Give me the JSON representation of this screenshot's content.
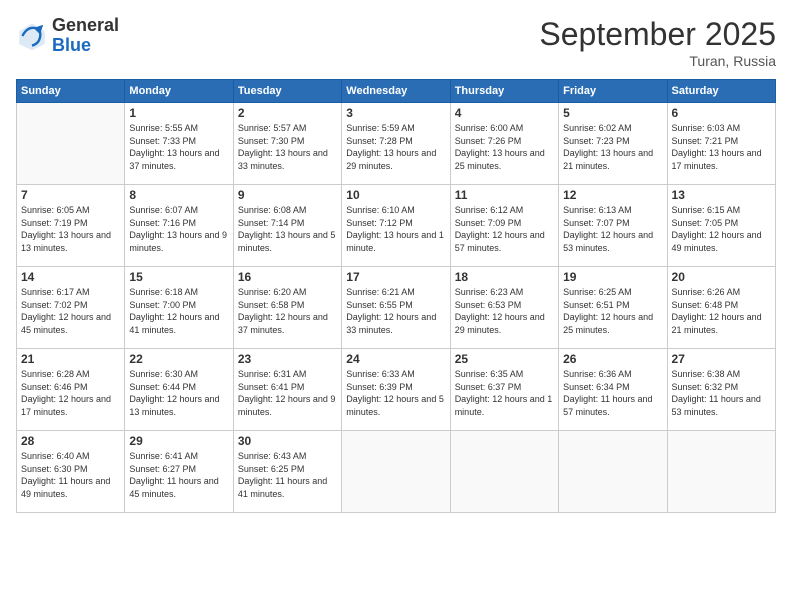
{
  "logo": {
    "general": "General",
    "blue": "Blue"
  },
  "title": {
    "month_year": "September 2025",
    "location": "Turan, Russia"
  },
  "weekdays": [
    "Sunday",
    "Monday",
    "Tuesday",
    "Wednesday",
    "Thursday",
    "Friday",
    "Saturday"
  ],
  "weeks": [
    [
      {
        "day": "",
        "sunrise": "",
        "sunset": "",
        "daylight": ""
      },
      {
        "day": "1",
        "sunrise": "Sunrise: 5:55 AM",
        "sunset": "Sunset: 7:33 PM",
        "daylight": "Daylight: 13 hours and 37 minutes."
      },
      {
        "day": "2",
        "sunrise": "Sunrise: 5:57 AM",
        "sunset": "Sunset: 7:30 PM",
        "daylight": "Daylight: 13 hours and 33 minutes."
      },
      {
        "day": "3",
        "sunrise": "Sunrise: 5:59 AM",
        "sunset": "Sunset: 7:28 PM",
        "daylight": "Daylight: 13 hours and 29 minutes."
      },
      {
        "day": "4",
        "sunrise": "Sunrise: 6:00 AM",
        "sunset": "Sunset: 7:26 PM",
        "daylight": "Daylight: 13 hours and 25 minutes."
      },
      {
        "day": "5",
        "sunrise": "Sunrise: 6:02 AM",
        "sunset": "Sunset: 7:23 PM",
        "daylight": "Daylight: 13 hours and 21 minutes."
      },
      {
        "day": "6",
        "sunrise": "Sunrise: 6:03 AM",
        "sunset": "Sunset: 7:21 PM",
        "daylight": "Daylight: 13 hours and 17 minutes."
      }
    ],
    [
      {
        "day": "7",
        "sunrise": "Sunrise: 6:05 AM",
        "sunset": "Sunset: 7:19 PM",
        "daylight": "Daylight: 13 hours and 13 minutes."
      },
      {
        "day": "8",
        "sunrise": "Sunrise: 6:07 AM",
        "sunset": "Sunset: 7:16 PM",
        "daylight": "Daylight: 13 hours and 9 minutes."
      },
      {
        "day": "9",
        "sunrise": "Sunrise: 6:08 AM",
        "sunset": "Sunset: 7:14 PM",
        "daylight": "Daylight: 13 hours and 5 minutes."
      },
      {
        "day": "10",
        "sunrise": "Sunrise: 6:10 AM",
        "sunset": "Sunset: 7:12 PM",
        "daylight": "Daylight: 13 hours and 1 minute."
      },
      {
        "day": "11",
        "sunrise": "Sunrise: 6:12 AM",
        "sunset": "Sunset: 7:09 PM",
        "daylight": "Daylight: 12 hours and 57 minutes."
      },
      {
        "day": "12",
        "sunrise": "Sunrise: 6:13 AM",
        "sunset": "Sunset: 7:07 PM",
        "daylight": "Daylight: 12 hours and 53 minutes."
      },
      {
        "day": "13",
        "sunrise": "Sunrise: 6:15 AM",
        "sunset": "Sunset: 7:05 PM",
        "daylight": "Daylight: 12 hours and 49 minutes."
      }
    ],
    [
      {
        "day": "14",
        "sunrise": "Sunrise: 6:17 AM",
        "sunset": "Sunset: 7:02 PM",
        "daylight": "Daylight: 12 hours and 45 minutes."
      },
      {
        "day": "15",
        "sunrise": "Sunrise: 6:18 AM",
        "sunset": "Sunset: 7:00 PM",
        "daylight": "Daylight: 12 hours and 41 minutes."
      },
      {
        "day": "16",
        "sunrise": "Sunrise: 6:20 AM",
        "sunset": "Sunset: 6:58 PM",
        "daylight": "Daylight: 12 hours and 37 minutes."
      },
      {
        "day": "17",
        "sunrise": "Sunrise: 6:21 AM",
        "sunset": "Sunset: 6:55 PM",
        "daylight": "Daylight: 12 hours and 33 minutes."
      },
      {
        "day": "18",
        "sunrise": "Sunrise: 6:23 AM",
        "sunset": "Sunset: 6:53 PM",
        "daylight": "Daylight: 12 hours and 29 minutes."
      },
      {
        "day": "19",
        "sunrise": "Sunrise: 6:25 AM",
        "sunset": "Sunset: 6:51 PM",
        "daylight": "Daylight: 12 hours and 25 minutes."
      },
      {
        "day": "20",
        "sunrise": "Sunrise: 6:26 AM",
        "sunset": "Sunset: 6:48 PM",
        "daylight": "Daylight: 12 hours and 21 minutes."
      }
    ],
    [
      {
        "day": "21",
        "sunrise": "Sunrise: 6:28 AM",
        "sunset": "Sunset: 6:46 PM",
        "daylight": "Daylight: 12 hours and 17 minutes."
      },
      {
        "day": "22",
        "sunrise": "Sunrise: 6:30 AM",
        "sunset": "Sunset: 6:44 PM",
        "daylight": "Daylight: 12 hours and 13 minutes."
      },
      {
        "day": "23",
        "sunrise": "Sunrise: 6:31 AM",
        "sunset": "Sunset: 6:41 PM",
        "daylight": "Daylight: 12 hours and 9 minutes."
      },
      {
        "day": "24",
        "sunrise": "Sunrise: 6:33 AM",
        "sunset": "Sunset: 6:39 PM",
        "daylight": "Daylight: 12 hours and 5 minutes."
      },
      {
        "day": "25",
        "sunrise": "Sunrise: 6:35 AM",
        "sunset": "Sunset: 6:37 PM",
        "daylight": "Daylight: 12 hours and 1 minute."
      },
      {
        "day": "26",
        "sunrise": "Sunrise: 6:36 AM",
        "sunset": "Sunset: 6:34 PM",
        "daylight": "Daylight: 11 hours and 57 minutes."
      },
      {
        "day": "27",
        "sunrise": "Sunrise: 6:38 AM",
        "sunset": "Sunset: 6:32 PM",
        "daylight": "Daylight: 11 hours and 53 minutes."
      }
    ],
    [
      {
        "day": "28",
        "sunrise": "Sunrise: 6:40 AM",
        "sunset": "Sunset: 6:30 PM",
        "daylight": "Daylight: 11 hours and 49 minutes."
      },
      {
        "day": "29",
        "sunrise": "Sunrise: 6:41 AM",
        "sunset": "Sunset: 6:27 PM",
        "daylight": "Daylight: 11 hours and 45 minutes."
      },
      {
        "day": "30",
        "sunrise": "Sunrise: 6:43 AM",
        "sunset": "Sunset: 6:25 PM",
        "daylight": "Daylight: 11 hours and 41 minutes."
      },
      {
        "day": "",
        "sunrise": "",
        "sunset": "",
        "daylight": ""
      },
      {
        "day": "",
        "sunrise": "",
        "sunset": "",
        "daylight": ""
      },
      {
        "day": "",
        "sunrise": "",
        "sunset": "",
        "daylight": ""
      },
      {
        "day": "",
        "sunrise": "",
        "sunset": "",
        "daylight": ""
      }
    ]
  ]
}
